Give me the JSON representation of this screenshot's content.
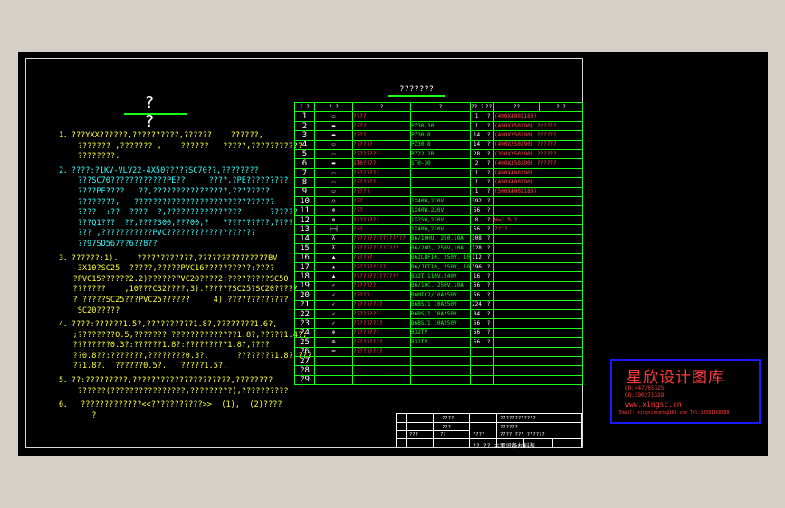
{
  "drawing": {
    "title": "? ?",
    "notes": [
      "1．???YXX??????,??????????,??????    ??????,\n    ??????? ,??????? ,    ??????   ?????,???????????\n    ????????.",
      "2．????:?1KV-VLV22-4X50?????SC70??,????????\n    ???SC70????????????PE??     ????,?PE?????????\n    ????PE????   ??,????????????????,????????\n    ????????,   ??????????????????????????????\n    ????  :??  ????  ?,????????????????      ??????\n    ???Q1???  ??,????300,??700,?   ??????????,????\n    ??? ,???????????PVC???????????????????\n    ??97SD567??6??8??",
      "3．??????:1).    ????????????,???????????????BV\n   -3X10?SC25  ?????,?????PVC16??????????:????\n   ?PVC15??????2.2)??????PVC20????2;?????????SC50\n   ???????    ,10???C32????,3).??????SC25?SC20?????\n   ? ?????SC25???PVC25??????     4).?????????????\n    SC20?????",
      "4．????:??????1.5?,??????????1.8?,????????1.6?,\n   ;????????0.5,??????? ??????????????1.8?,?????1.4?;\n   ????????0.3?:??????1.8?:?????????1.8?,????\n   ??0.8??:???????,????????0.3?.      ????????1.8? ???\n   ??1.8?.  ??????0.5?.   ?????1.5?.",
      "5．??:?????????,?????????????????????,????????\n    ??????(????????????????,?????????),??????????",
      "6．  ?????????????<<???????????>>  (1),  (2)????\n       ?"
    ],
    "table": {
      "title": "???????",
      "headers": [
        "? ?",
        "? ?",
        "?",
        "?",
        "??  ?  ??",
        "??",
        "??",
        "?  ?"
      ],
      "rows": [
        {
          "no": "1",
          "sym": "▭",
          "name": "????",
          "model": "",
          "qty": "1",
          "unit": "?",
          "remark": "(400X400X180)"
        },
        {
          "no": "2",
          "sym": "▬",
          "name": "????",
          "model": "PZ30-30",
          "qty": "1",
          "unit": "?",
          "remark": "(400X350X90)   ??????"
        },
        {
          "no": "3",
          "sym": "▬",
          "name": "????",
          "model": "PZ30-8",
          "qty": "14",
          "unit": "?",
          "remark": "(400X250X90)   ??????"
        },
        {
          "no": "4",
          "sym": "▭",
          "name": "??????",
          "model": "PZ30-8",
          "qty": "14",
          "unit": "?",
          "remark": "(400X250X90)   ??????"
        },
        {
          "no": "5",
          "sym": "▭",
          "name": "????????",
          "model": "PZ22-?R",
          "qty": "28",
          "unit": "?",
          "remark": "(350X250X90)   ??????"
        },
        {
          "no": "6",
          "sym": "▬",
          "name": "ST0????",
          "model": "ST0-30",
          "qty": "2",
          "unit": "?",
          "remark": "(400X350X90)   ??????"
        },
        {
          "no": "7",
          "sym": "▭",
          "name": "????????",
          "model": "",
          "qty": "1",
          "unit": "?",
          "remark": "(400X400X90)"
        },
        {
          "no": "8",
          "sym": "▭",
          "name": "???????",
          "model": "",
          "qty": "1",
          "unit": "?",
          "remark": "(400X400X90)"
        },
        {
          "no": "9",
          "sym": "▭",
          "name": "?????",
          "model": "",
          "qty": "1",
          "unit": "?",
          "remark": "(500X400X180)"
        },
        {
          "no": "10",
          "sym": "○",
          "name": "???",
          "model": "1X40W,220V",
          "qty": "392",
          "unit": "?",
          "remark": ""
        },
        {
          "no": "11",
          "sym": "⊗",
          "name": "???",
          "model": "1X40W,220V",
          "qty": "56",
          "unit": "?",
          "remark": ""
        },
        {
          "no": "12",
          "sym": "⊗",
          "name": "????????",
          "model": "1X25W,220V",
          "qty": "8",
          "unit": "?",
          "remark": "H=2.5  ?"
        },
        {
          "no": "13",
          "sym": "├─┤",
          "name": "???",
          "model": "1X40W,220V",
          "qty": "56",
          "unit": "?",
          "remark": "  ????"
        },
        {
          "no": "14",
          "sym": "⊼",
          "name": "????????????????",
          "model": "B6/10HU,  250,10A",
          "qty": "308",
          "unit": "?",
          "remark": ""
        },
        {
          "no": "15",
          "sym": "⊼",
          "name": "??????????????",
          "model": "B6/20D,  250V,10A",
          "qty": "128",
          "unit": "?",
          "remark": ""
        },
        {
          "no": "16",
          "sym": "▲",
          "name": "??????",
          "model": "B62LBF10,  250V,  10A",
          "qty": "112",
          "unit": "?",
          "remark": ""
        },
        {
          "no": "17",
          "sym": "▲",
          "name": "??????????",
          "model": "B6/JFT10,  250V,  10A",
          "qty": "196",
          "unit": "?",
          "remark": ""
        },
        {
          "no": "18",
          "sym": "▲",
          "name": "??????????????",
          "model": "B32T  110V,240V",
          "qty": "16",
          "unit": "?",
          "remark": ""
        },
        {
          "no": "19",
          "sym": "✓",
          "name": "???????",
          "model": "B6/10C,  250V,10A",
          "qty": "56",
          "unit": "?",
          "remark": ""
        },
        {
          "no": "20",
          "sym": "✓",
          "name": "?????",
          "model": "B6MIC2/10A250V",
          "qty": "56",
          "unit": "?",
          "remark": ""
        },
        {
          "no": "21",
          "sym": "✓",
          "name": "?????????",
          "model": "B6BS/1  10A250V",
          "qty": "224",
          "unit": "?",
          "remark": ""
        },
        {
          "no": "22",
          "sym": "✓",
          "name": "????????",
          "model": "B6BS/1  10A250V",
          "qty": "84",
          "unit": "?",
          "remark": ""
        },
        {
          "no": "23",
          "sym": "✓",
          "name": "?????????",
          "model": "B6BS/1  10A250V",
          "qty": "56",
          "unit": "?",
          "remark": ""
        },
        {
          "no": "24",
          "sym": "⊕",
          "name": "????????",
          "model": "B32TV",
          "qty": "56",
          "unit": "?",
          "remark": ""
        },
        {
          "no": "25",
          "sym": "⊞",
          "name": "?????????",
          "model": "B32TV",
          "qty": "56",
          "unit": "?",
          "remark": ""
        },
        {
          "no": "26",
          "sym": "━",
          "name": "?????????",
          "model": "",
          "qty": "",
          "unit": "",
          "remark": ""
        },
        {
          "no": "27",
          "sym": "",
          "name": "",
          "model": "",
          "qty": "",
          "unit": "",
          "remark": ""
        },
        {
          "no": "28",
          "sym": "",
          "name": "",
          "model": "",
          "qty": "",
          "unit": "",
          "remark": ""
        },
        {
          "no": "29",
          "sym": "",
          "name": "",
          "model": "",
          "qty": "",
          "unit": "",
          "remark": ""
        }
      ]
    },
    "title_block": {
      "designer_label": "????",
      "project": "????????????",
      "sheet_name": "??????",
      "stamp": "???",
      "bottom_left": "???",
      "bottom_mid": "??",
      "bottom_right": "????",
      "caption": "????   ???    ??????",
      "footer": "??     ??     主要设备材料表"
    }
  },
  "watermark": {
    "brand": "星欣设计图库",
    "qq1": "QQ:447285325",
    "qq2": "QQ:390271328",
    "site": "www.xingsc.cn",
    "email": "Email:  xingxinsehe@163.com   Tel:13581168888"
  },
  "colors": {
    "background": "#d4d0c8",
    "canvas": "#000000",
    "line_green": "#19ff19",
    "text_yellow": "#ffff33",
    "text_cyan": "#33ffff",
    "watermark_red": "#ff3a3a",
    "watermark_border": "#1a1aff"
  }
}
